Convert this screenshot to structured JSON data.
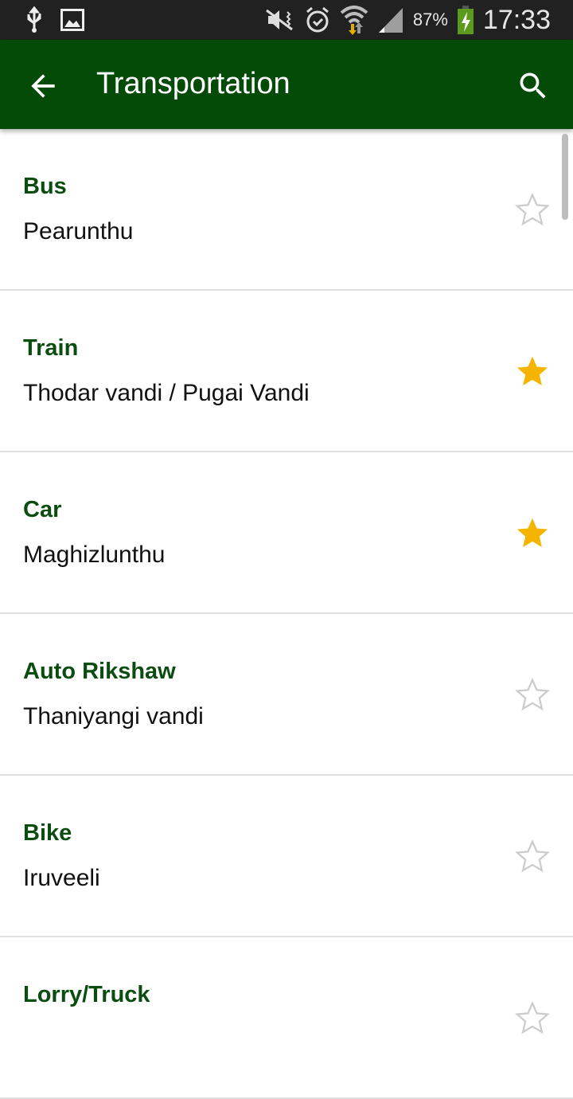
{
  "status_bar": {
    "battery_percent": "87%",
    "time": "17:33",
    "icons": [
      "usb-icon",
      "image-icon",
      "mute-icon",
      "alarm-icon",
      "wifi-icon",
      "signal-icon",
      "battery-charging-icon"
    ]
  },
  "app_bar": {
    "title": "Transportation",
    "back_icon": "arrow-back-icon",
    "search_icon": "search-icon"
  },
  "colors": {
    "primary": "#044b08",
    "title_text": "#0b4d10",
    "star_active": "#f4b400",
    "star_inactive": "#cccccc"
  },
  "items": [
    {
      "name": "Bus",
      "translation": "Pearunthu",
      "favorite": false
    },
    {
      "name": "Train",
      "translation": "Thodar vandi / Pugai Vandi",
      "favorite": true
    },
    {
      "name": "Car",
      "translation": "Maghizlunthu",
      "favorite": true
    },
    {
      "name": "Auto Rikshaw",
      "translation": "Thaniyangi vandi",
      "favorite": false
    },
    {
      "name": "Bike",
      "translation": "Iruveeli",
      "favorite": false
    },
    {
      "name": "Lorry/Truck",
      "translation": "",
      "favorite": false
    }
  ]
}
